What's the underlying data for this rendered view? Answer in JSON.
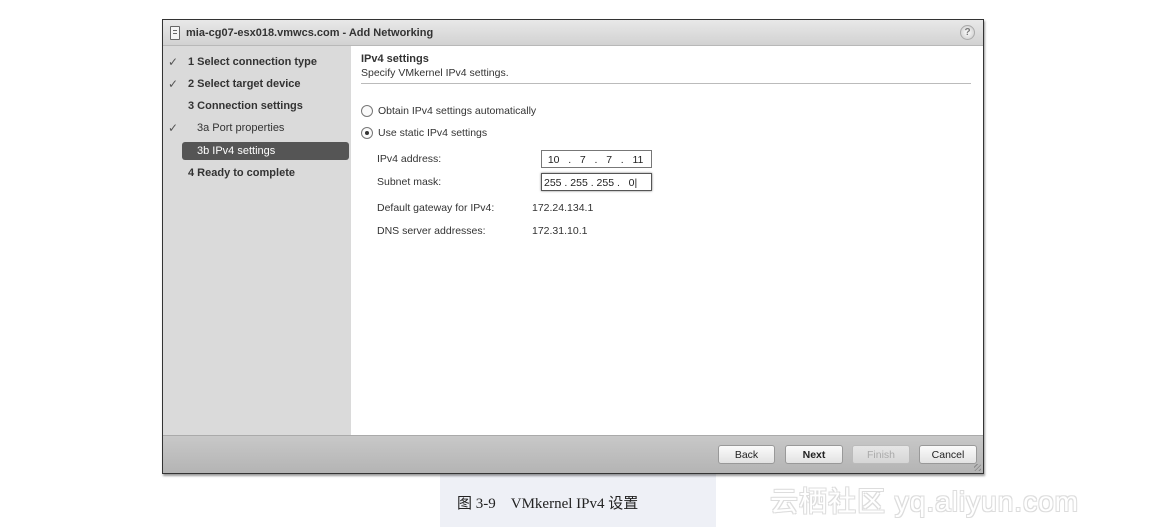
{
  "window": {
    "title": "mia-cg07-esx018.vmwcs.com - Add Networking",
    "help_glyph": "?"
  },
  "sidebar": {
    "steps": [
      {
        "label": "1  Select connection type",
        "completed": true,
        "check": "✓"
      },
      {
        "label": "2  Select target device",
        "completed": true,
        "check": "✓"
      },
      {
        "label": "3  Connection settings",
        "completed": false,
        "check": ""
      },
      {
        "label": "3a  Port properties",
        "completed": true,
        "check": "✓"
      },
      {
        "label": "3b  IPv4 settings",
        "completed": false,
        "active": true,
        "check": ""
      },
      {
        "label": "4  Ready to complete",
        "completed": false,
        "check": ""
      }
    ]
  },
  "main": {
    "title": "IPv4 settings",
    "subtitle": "Specify VMkernel IPv4 settings.",
    "options": [
      {
        "label": "Obtain IPv4 settings automatically",
        "selected": false
      },
      {
        "label": "Use static IPv4 settings",
        "selected": true
      }
    ],
    "fields": {
      "ipv4_address": {
        "label": "IPv4 address:",
        "octets": [
          "10",
          "7",
          "7",
          "11"
        ],
        "display": "  10   .   7   .   7   .   11"
      },
      "subnet_mask": {
        "label": "Subnet mask:",
        "octets": [
          "255",
          "255",
          "255",
          "0"
        ],
        "display": "255 . 255 . 255 .   0|"
      },
      "gateway": {
        "label": "Default gateway for IPv4:",
        "value": "172.24.134.1"
      },
      "dns": {
        "label": "DNS server addresses:",
        "value": "172.31.10.1"
      }
    }
  },
  "footer": {
    "back": "Back",
    "next": "Next",
    "finish": "Finish",
    "cancel": "Cancel"
  },
  "caption": "图 3-9    VMkernel IPv4 设置",
  "watermark": "云栖社区 yq.aliyun.com"
}
